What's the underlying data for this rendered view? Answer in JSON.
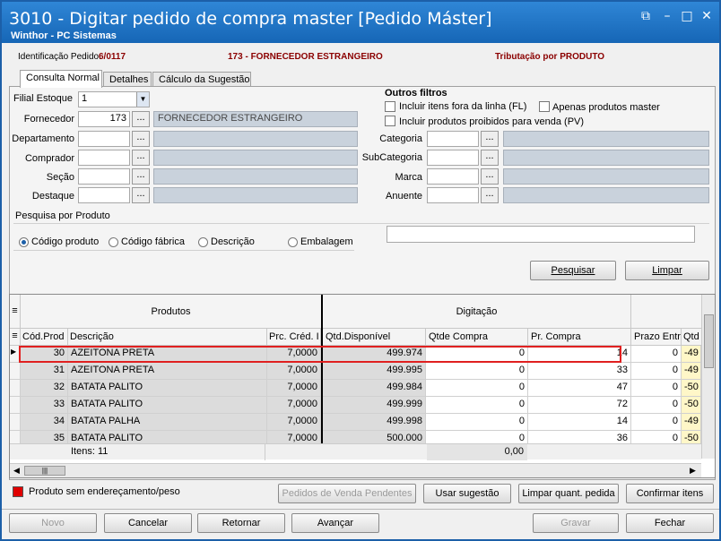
{
  "window": {
    "title": "3010 - Digitar pedido de compra master [Pedido Máster]",
    "subtitle": "Winthor - PC Sistemas"
  },
  "header": {
    "id_label": "Identificação Pedido:",
    "id_value": "6/0117",
    "supplier": "173 - FORNECEDOR ESTRANGEIRO",
    "tax": "Tributação por PRODUTO"
  },
  "tabs": [
    "Consulta Normal",
    "Detalhes",
    "Cálculo da Sugestão"
  ],
  "filters": {
    "filial_label": "Filial Estoque",
    "filial_value": "1",
    "fornecedor_label": "Fornecedor",
    "fornecedor_code": "173",
    "fornecedor_name": "FORNECEDOR ESTRANGEIRO",
    "departamento_label": "Departamento",
    "comprador_label": "Comprador",
    "secao_label": "Seção",
    "destaque_label": "Destaque",
    "outros_title": "Outros filtros",
    "chk_fl": "Incluir itens fora da linha (FL)",
    "chk_master": "Apenas produtos master",
    "chk_pv": "Incluir produtos proibidos para venda (PV)",
    "categoria_label": "Categoria",
    "subcategoria_label": "SubCategoria",
    "marca_label": "Marca",
    "anuente_label": "Anuente",
    "dots": "..."
  },
  "search": {
    "title": "Pesquisa por Produto",
    "options": [
      "Código produto",
      "Código fábrica",
      "Descrição",
      "Embalagem"
    ],
    "selected": "Código produto",
    "pesquisar": "Pesquisar",
    "limpar": "Limpar"
  },
  "grid": {
    "group_produtos": "Produtos",
    "group_digitacao": "Digitação",
    "columns": [
      "Cód.Prod",
      "Descrição",
      "Prc. Créd. I",
      "Qtd.Disponível",
      "Qtde Compra",
      "Pr. Compra",
      "Prazo Entr",
      "Qtd"
    ],
    "rows": [
      {
        "cod": "30",
        "desc": "AZEITONA PRETA",
        "prc": "7,0000",
        "disp": "499.974",
        "qtde": "0",
        "pr": "14",
        "prazo": "0",
        "qtd": "-49"
      },
      {
        "cod": "31",
        "desc": "AZEITONA PRETA",
        "prc": "7,0000",
        "disp": "499.995",
        "qtde": "0",
        "pr": "33",
        "prazo": "0",
        "qtd": "-49"
      },
      {
        "cod": "32",
        "desc": "BATATA PALITO",
        "prc": "7,0000",
        "disp": "499.984",
        "qtde": "0",
        "pr": "47",
        "prazo": "0",
        "qtd": "-50"
      },
      {
        "cod": "33",
        "desc": "BATATA PALITO",
        "prc": "7,0000",
        "disp": "499.999",
        "qtde": "0",
        "pr": "72",
        "prazo": "0",
        "qtd": "-50"
      },
      {
        "cod": "34",
        "desc": "BATATA PALHA",
        "prc": "7,0000",
        "disp": "499.998",
        "qtde": "0",
        "pr": "14",
        "prazo": "0",
        "qtd": "-49"
      },
      {
        "cod": "35",
        "desc": "BATATA PALITO",
        "prc": "7,0000",
        "disp": "500.000",
        "qtde": "0",
        "pr": "36",
        "prazo": "0",
        "qtd": "-50"
      }
    ],
    "footer_items": "Itens: 11",
    "footer_total": "0,00"
  },
  "legend": {
    "text": "Produto sem endereçamento/peso",
    "color": "#e00000"
  },
  "actions": {
    "pendentes": "Pedidos de Venda Pendentes",
    "sugestao": "Usar sugestão",
    "limpar_quant": "Limpar quant. pedida",
    "confirmar": "Confirmar itens"
  },
  "footer": {
    "novo": "Novo",
    "cancelar": "Cancelar",
    "retornar": "Retornar",
    "avancar": "Avançar",
    "gravar": "Gravar",
    "fechar": "Fechar"
  }
}
